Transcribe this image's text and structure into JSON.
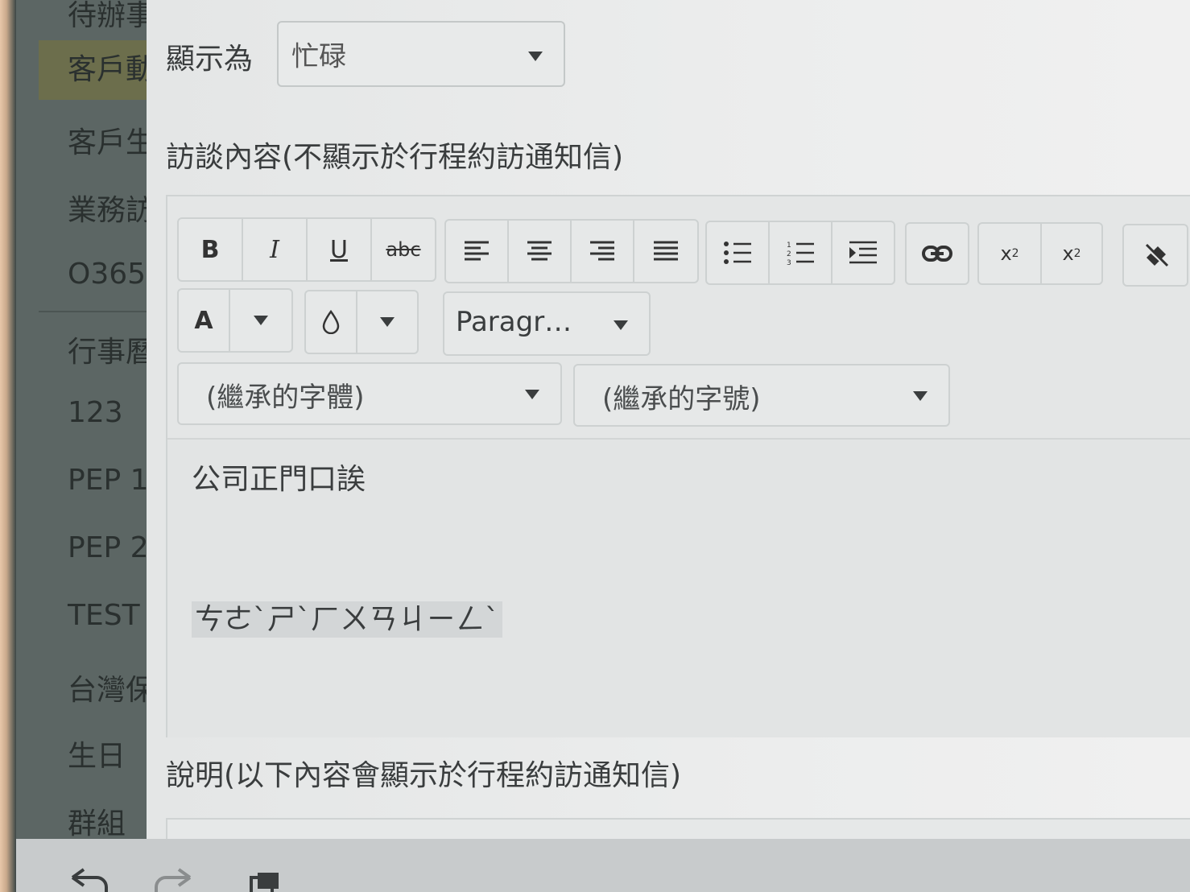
{
  "sidebar": {
    "items": [
      {
        "label": "待辦事",
        "active": false
      },
      {
        "label": "客戶動",
        "active": true
      },
      {
        "label": "客戶生",
        "active": false
      },
      {
        "label": "業務訪",
        "active": false
      },
      {
        "label": "O365",
        "active": false
      },
      {
        "label": "行事曆",
        "active": false
      },
      {
        "label": "123",
        "active": false
      },
      {
        "label": "PEP 1",
        "active": false
      },
      {
        "label": "PEP 2",
        "active": false
      },
      {
        "label": "TEST",
        "active": false
      },
      {
        "label": "台灣保",
        "active": false
      },
      {
        "label": "生日",
        "active": false
      },
      {
        "label": "群組",
        "active": false
      }
    ]
  },
  "form": {
    "show_as_label": "顯示為",
    "show_as_value": "忙碌",
    "interview_label": "訪談內容(不顯示於行程約訪通知信)",
    "description_label": "說明(以下內容會顯示於行程約訪通知信)"
  },
  "toolbar": {
    "bold": "B",
    "italic": "I",
    "underline": "U",
    "strikethrough": "abc",
    "font_color": "A",
    "paragraph": "Paragr…",
    "font_family": "(繼承的字體)",
    "font_size": "(繼承的字號)",
    "subscript": "x",
    "subscript_mark": "2",
    "superscript": "x",
    "superscript_mark": "2"
  },
  "editor": {
    "lines": [
      "公司正門口誒",
      "ㄘㄜˋㄕˋㄏㄨㄢㄐㄧㄥˋ"
    ]
  },
  "colors": {
    "sidebar_bg": "#5c6664",
    "active_item": "#6c6e4c",
    "panel_bg": "#e4e6e6"
  }
}
